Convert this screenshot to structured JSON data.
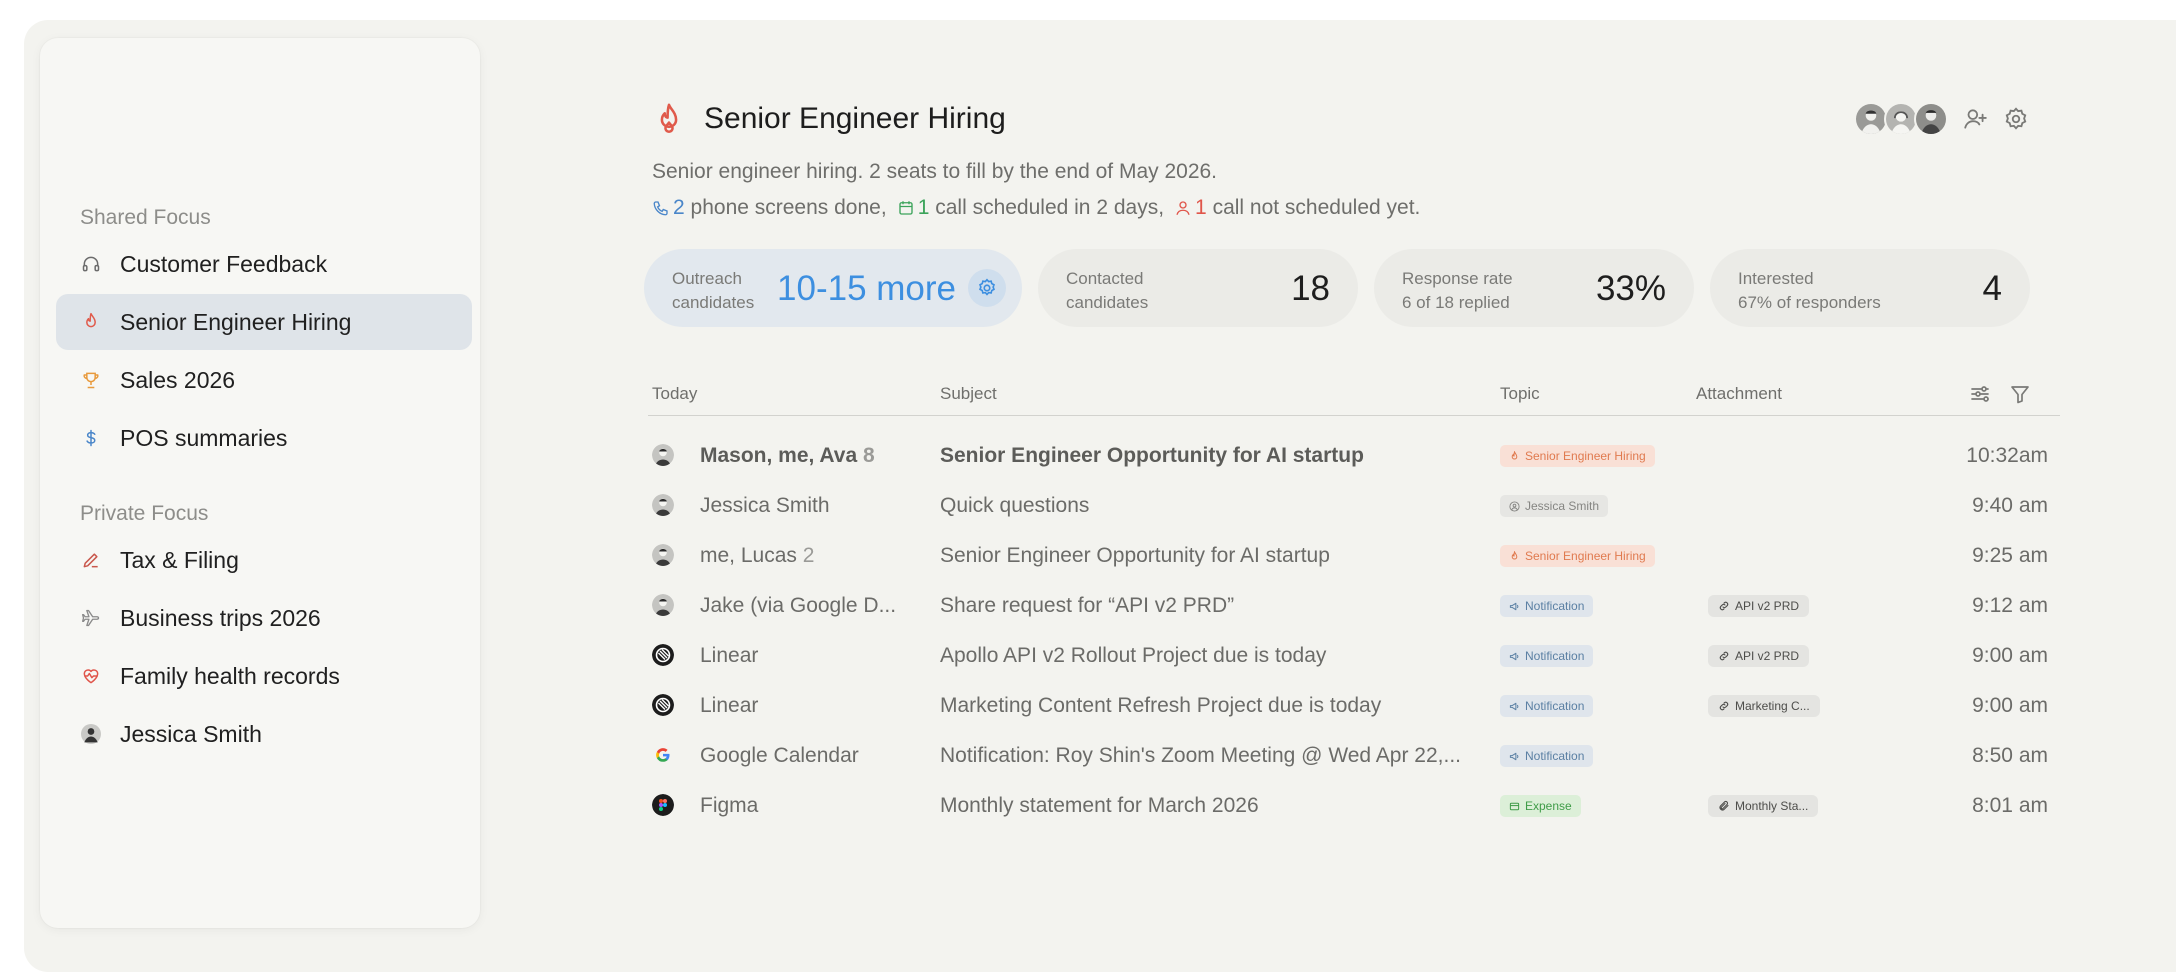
{
  "sidebar": {
    "shared_label": "Shared Focus",
    "private_label": "Private Focus",
    "shared_items": [
      {
        "label": "Customer Feedback",
        "icon": "headphones-icon",
        "color": "#6b6b6b"
      },
      {
        "label": "Senior Engineer Hiring",
        "icon": "flame-icon",
        "color": "#e05a4b",
        "active": true
      },
      {
        "label": "Sales 2026",
        "icon": "trophy-icon",
        "color": "#e89a3c"
      },
      {
        "label": "POS summaries",
        "icon": "dollar-icon",
        "color": "#4a86c9"
      }
    ],
    "private_items": [
      {
        "label": "Tax & Filing",
        "icon": "pen-icon",
        "color": "#c9584d"
      },
      {
        "label": "Business trips 2026",
        "icon": "plane-icon",
        "color": "#8a8a8a"
      },
      {
        "label": "Family health records",
        "icon": "heart-pulse-icon",
        "color": "#e0554a"
      },
      {
        "label": "Jessica Smith",
        "icon": "avatar",
        "color": "#555555"
      }
    ]
  },
  "header": {
    "title": "Senior Engineer Hiring",
    "description": "Senior engineer hiring. 2 seats to fill by the end of May 2026.",
    "summary": {
      "phone_count": "2",
      "phone_text": "phone screens done,",
      "scheduled_count": "1",
      "scheduled_text": "call scheduled in 2 days,",
      "unscheduled_count": "1",
      "unscheduled_text": "call not scheduled yet."
    }
  },
  "stats": [
    {
      "label1": "Outreach",
      "label2": "candidates",
      "value": "10-15 more"
    },
    {
      "label1": "Contacted",
      "label2": "candidates",
      "value": "18"
    },
    {
      "label1": "Response rate",
      "label2": "6 of 18 replied",
      "value": "33%"
    },
    {
      "label1": "Interested",
      "label2": "67% of responders",
      "value": "4"
    }
  ],
  "table": {
    "columns": {
      "today": "Today",
      "subject": "Subject",
      "topic": "Topic",
      "attachment": "Attachment"
    },
    "rows": [
      {
        "from": "Mason, me, Ava",
        "count": "8",
        "subject": "Senior Engineer Opportunity for AI startup",
        "topic": "Senior Engineer Hiring",
        "topic_kind": "hire",
        "attachment": "",
        "time": "10:32am",
        "unread": true,
        "avatar": "person"
      },
      {
        "from": "Jessica Smith",
        "count": "",
        "subject": "Quick questions",
        "topic": "Jessica Smith",
        "topic_kind": "person",
        "attachment": "",
        "time": "9:40 am",
        "unread": false,
        "avatar": "person"
      },
      {
        "from": "me, Lucas",
        "count": "2",
        "subject": "Senior Engineer Opportunity for AI startup",
        "topic": "Senior Engineer Hiring",
        "topic_kind": "hire",
        "attachment": "",
        "time": "9:25 am",
        "unread": false,
        "avatar": "person"
      },
      {
        "from": "Jake (via Google D...",
        "count": "",
        "subject": "Share request for “API v2 PRD”",
        "topic": "Notification",
        "topic_kind": "notif",
        "attachment": "API v2 PRD",
        "attachment_icon": "link",
        "time": "9:12 am",
        "unread": false,
        "avatar": "person"
      },
      {
        "from": "Linear",
        "count": "",
        "subject": "Apollo API v2 Rollout Project due is today",
        "topic": "Notification",
        "topic_kind": "notif",
        "attachment": "API v2 PRD",
        "attachment_icon": "link",
        "time": "9:00 am",
        "unread": false,
        "avatar": "linear"
      },
      {
        "from": "Linear",
        "count": "",
        "subject": "Marketing Content Refresh Project due is today",
        "topic": "Notification",
        "topic_kind": "notif",
        "attachment": "Marketing C...",
        "attachment_icon": "link",
        "time": "9:00 am",
        "unread": false,
        "avatar": "linear"
      },
      {
        "from": "Google Calendar",
        "count": "",
        "subject": "Notification: Roy Shin's Zoom Meeting @ Wed Apr 22,...",
        "topic": "Notification",
        "topic_kind": "notif",
        "attachment": "",
        "time": "8:50 am",
        "unread": false,
        "avatar": "google"
      },
      {
        "from": "Figma",
        "count": "",
        "subject": "Monthly statement for March 2026",
        "topic": "Expense",
        "topic_kind": "exp",
        "attachment": "Monthly Sta...",
        "attachment_icon": "clip",
        "time": "8:01 am",
        "unread": false,
        "avatar": "figma"
      }
    ]
  }
}
